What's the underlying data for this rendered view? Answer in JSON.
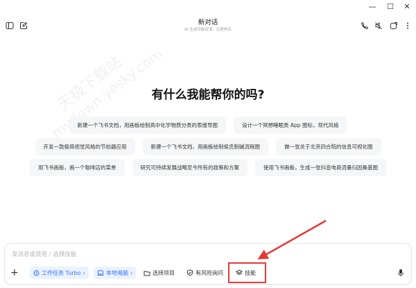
{
  "window": {
    "minimize": "—",
    "maximize": "☐",
    "close": "✕"
  },
  "header": {
    "title": "新对话",
    "subtitle": "AI 生成可能有误，注意核实"
  },
  "main": {
    "heading": "有什么我能帮你的吗?",
    "suggestions": [
      [
        "新建一个飞书文档，用画板绘制高中化学物质分类的思维导图",
        "设计一个冥想睡眠类 App 图标，现代风格"
      ],
      [
        "开发一款极简视觉风格的节拍器应用",
        "新建一个飞书文档，用画板绘制侯氏制碱流程图",
        "做一张关于北京四合院的信息可视化图"
      ],
      [
        "用飞书画板，画一个咖啡店的菜单",
        "研究可持续发展战略至今所有的政策和方案",
        "使用飞书画板，生成一张抖音电商流量归因桑基图"
      ]
    ]
  },
  "composer": {
    "placeholder": "发消息或使用 / 选择技能",
    "tools": {
      "task": "工作任务 Turbo",
      "local": "本地电脑",
      "project": "选择项目",
      "risk": "有风险询问",
      "skills": "技能"
    }
  },
  "watermark": {
    "line1": "天极下载站",
    "line2": "mydown.yesky.com"
  },
  "colors": {
    "accent": "#3370ff",
    "annotation": "#e53935"
  }
}
